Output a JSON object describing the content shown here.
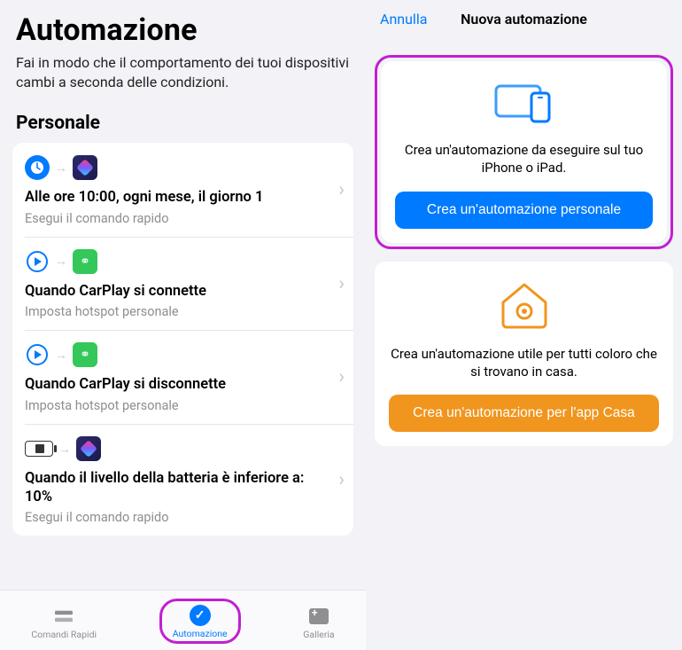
{
  "left": {
    "title": "Automazione",
    "subtitle": "Fai in modo che il comportamento dei tuoi dispositivi cambi a seconda delle condizioni.",
    "sectionTitle": "Personale",
    "rows": [
      {
        "title": "Alle ore 10:00, ogni mese, il giorno 1",
        "sub": "Esegui il comando rapido"
      },
      {
        "title": "Quando CarPlay si connette",
        "sub": "Imposta hotspot personale"
      },
      {
        "title": "Quando CarPlay si disconnette",
        "sub": "Imposta hotspot personale"
      },
      {
        "title": "Quando il livello della batteria è inferiore a: 10%",
        "sub": "Esegui il comando rapido"
      }
    ],
    "tabs": {
      "shortcuts": "Comandi Rapidi",
      "automation": "Automazione",
      "gallery": "Galleria"
    }
  },
  "right": {
    "cancel": "Annulla",
    "title": "Nuova automazione",
    "personal": {
      "text": "Crea un'automazione da eseguire sul tuo iPhone o iPad.",
      "button": "Crea un'automazione personale"
    },
    "home": {
      "text": "Crea un'automazione utile per tutti coloro che si trovano in casa.",
      "button": "Crea un'automazione per l'app Casa"
    }
  }
}
